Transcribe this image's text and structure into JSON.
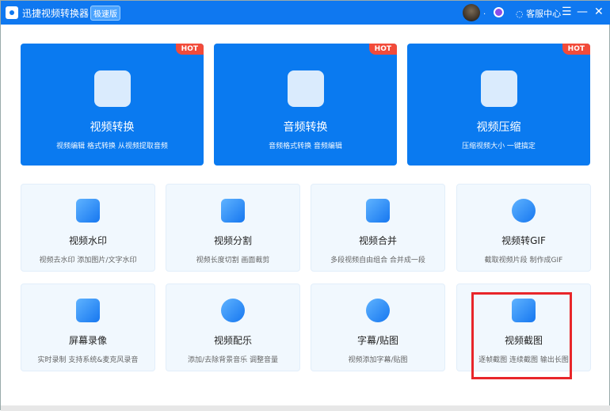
{
  "titlebar": {
    "app_title": "迅捷视频转换器",
    "edition_badge": "极速版",
    "avatar_dot": ".",
    "service": "客服中心",
    "menu": "☰",
    "minimize": "—",
    "close": "✕"
  },
  "big_cards": [
    {
      "title": "视频转换",
      "subtitle": "视频编辑 格式转换 从视频提取音频",
      "tag": "HOT"
    },
    {
      "title": "音频转换",
      "subtitle": "音频格式转换 音频编辑",
      "tag": "HOT"
    },
    {
      "title": "视频压缩",
      "subtitle": "压缩视频大小 一键搞定",
      "tag": "HOT"
    }
  ],
  "small_cards": [
    {
      "title": "视频水印",
      "subtitle": "视频去水印 添加图片/文字水印"
    },
    {
      "title": "视频分割",
      "subtitle": "视频长度切割 画面裁剪"
    },
    {
      "title": "视频合并",
      "subtitle": "多段视频自由组合 合并成一段"
    },
    {
      "title": "视频转GIF",
      "subtitle": "截取视频片段 制作成GIF"
    },
    {
      "title": "屏幕录像",
      "subtitle": "实时录制 支持系统&麦克风录音"
    },
    {
      "title": "视频配乐",
      "subtitle": "添加/去除背景音乐 调整音量"
    },
    {
      "title": "字幕/贴图",
      "subtitle": "视频添加字幕/贴图"
    },
    {
      "title": "视频截图",
      "subtitle": "逐帧截图 连续截图 输出长图"
    }
  ]
}
